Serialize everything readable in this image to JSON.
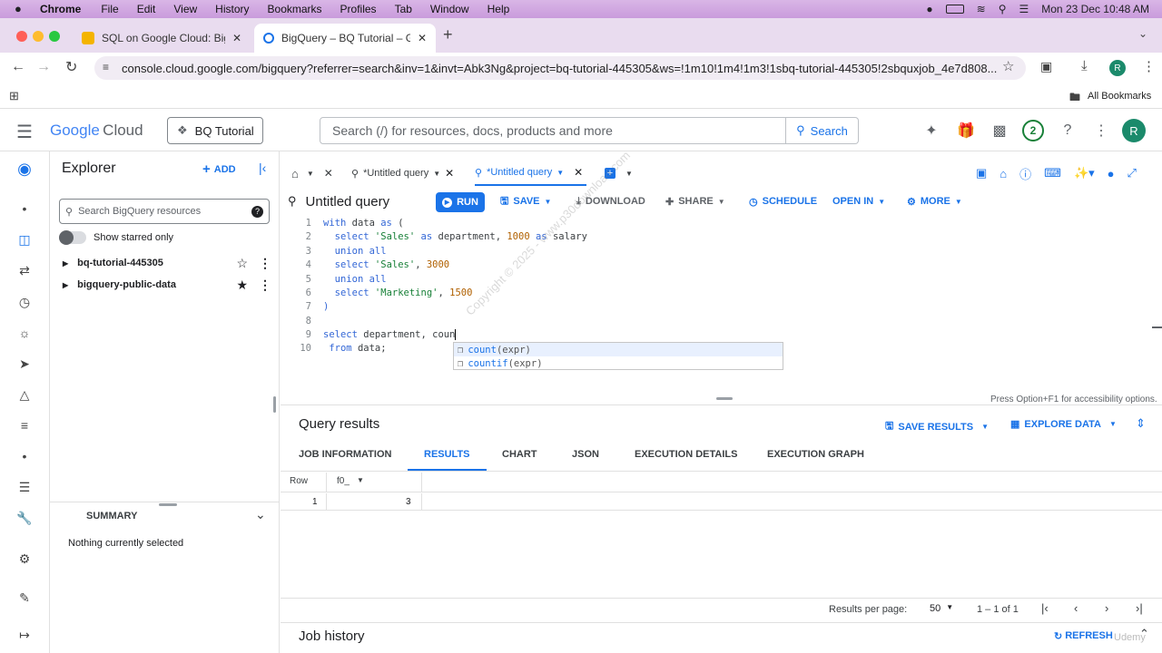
{
  "menubar": {
    "app": "Chrome",
    "items": [
      "File",
      "Edit",
      "View",
      "History",
      "Bookmarks",
      "Profiles",
      "Tab",
      "Window",
      "Help"
    ],
    "datetime": "Mon 23 Dec  10:48 AM"
  },
  "browser": {
    "tabs": [
      {
        "title": "SQL on Google Cloud: BigQu"
      },
      {
        "title": "BigQuery – BQ Tutorial – Goo"
      }
    ],
    "url": "console.cloud.google.com/bigquery?referrer=search&inv=1&invt=Abk3Ng&project=bq-tutorial-445305&ws=!1m10!1m4!1m3!1sbq-tutorial-445305!2sbquxjob_4e7d808...",
    "profile_initial": "R",
    "all_bookmarks": "All Bookmarks"
  },
  "header": {
    "logo_google": "Google",
    "logo_cloud": "Cloud",
    "project": "BQ Tutorial",
    "search_placeholder": "Search (/) for resources, docs, products and more",
    "search_button": "Search",
    "notification_count": "2",
    "avatar": "R"
  },
  "explorer": {
    "title": "Explorer",
    "add_label": "ADD",
    "search_placeholder": "Search BigQuery resources",
    "starred_toggle": "Show starred only",
    "items": [
      {
        "label": "bq-tutorial-445305",
        "star": "☆"
      },
      {
        "label": "bigquery-public-data",
        "star": "★"
      }
    ],
    "summary_title": "SUMMARY",
    "summary_text": "Nothing currently selected"
  },
  "query_tabs": [
    {
      "label": "*Untitled query"
    },
    {
      "label": "*Untitled query"
    }
  ],
  "toolbar": {
    "query_title": "Untitled query",
    "run": "RUN",
    "save": "SAVE",
    "download": "DOWNLOAD",
    "share": "SHARE",
    "schedule": "SCHEDULE",
    "open_in": "OPEN IN",
    "more": "MORE"
  },
  "editor": {
    "line_numbers": [
      "1",
      "2",
      "3",
      "4",
      "5",
      "6",
      "7",
      "8",
      "9",
      "10"
    ],
    "suggestions": [
      {
        "name": "count",
        "args": "(expr)"
      },
      {
        "name": "countif",
        "args": "(expr)"
      }
    ],
    "accessibility_hint": "Press Option+F1 for accessibility options.",
    "watermark": "Copyright © 2025 - www.p30download.com"
  },
  "results": {
    "title": "Query results",
    "save_results": "SAVE RESULTS",
    "explore_data": "EXPLORE DATA",
    "tabs": [
      "JOB INFORMATION",
      "RESULTS",
      "CHART",
      "JSON",
      "EXECUTION DETAILS",
      "EXECUTION GRAPH"
    ],
    "columns": [
      "Row",
      "f0_"
    ],
    "rows": [
      [
        "1",
        "3"
      ]
    ],
    "per_page_label": "Results per page:",
    "per_page_value": "50",
    "range": "1 – 1 of 1"
  },
  "job_history": {
    "title": "Job history",
    "refresh": "REFRESH",
    "udemy": "Udemy"
  }
}
